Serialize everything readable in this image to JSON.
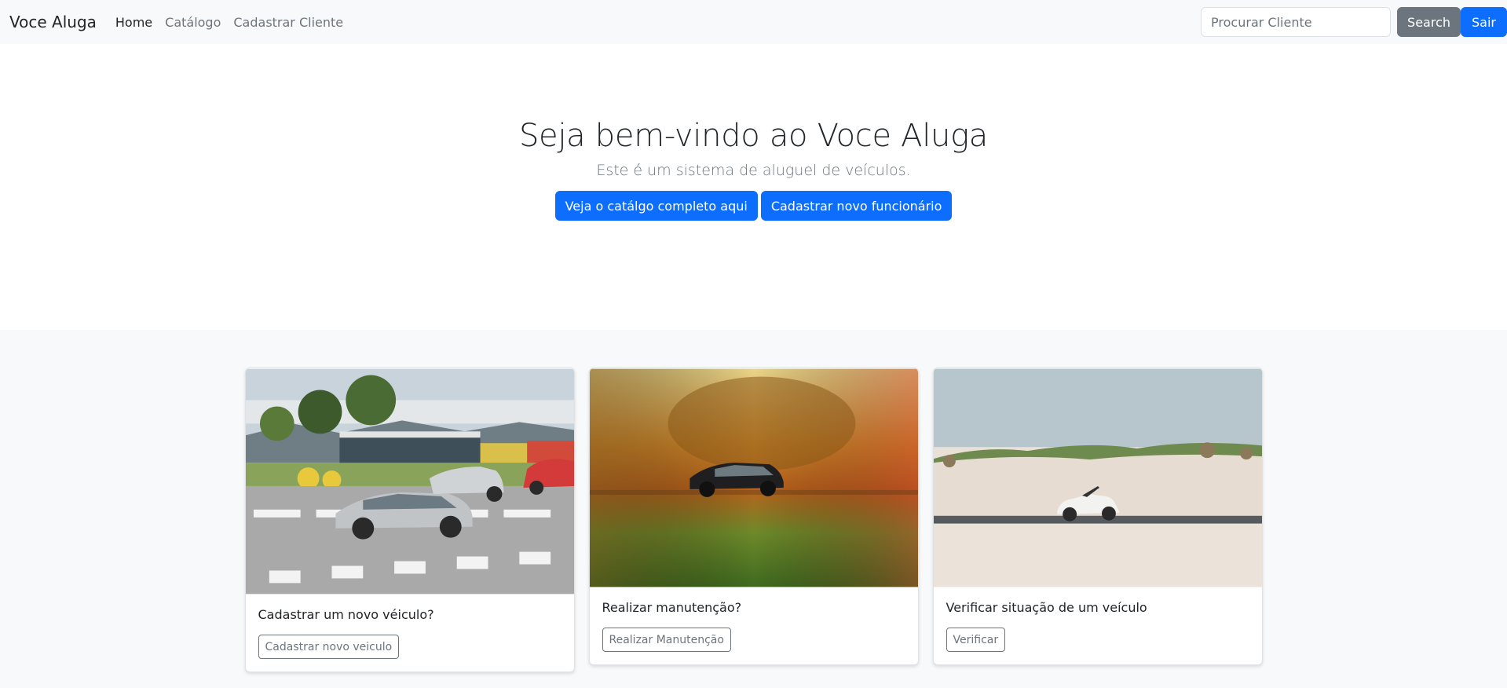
{
  "navbar": {
    "brand": "Voce Aluga",
    "links": [
      {
        "label": "Home"
      },
      {
        "label": "Catálogo"
      },
      {
        "label": "Cadastrar Cliente"
      }
    ],
    "search_placeholder": "Procurar Cliente",
    "search_button": "Search",
    "logout_button": "Sair"
  },
  "hero": {
    "title": "Seja bem-vindo ao Voce Aluga",
    "subtitle": "Este é um sistema de aluguel de veículos.",
    "primary_button": "Veja o catálgo completo aqui",
    "secondary_button": "Cadastrar novo funcionário"
  },
  "cards": [
    {
      "text": "Cadastrar um novo véiculo?",
      "button": "Cadastrar novo veiculo"
    },
    {
      "text": "Realizar manutenção?",
      "button": "Realizar Manutenção"
    },
    {
      "text": "Verificar situação de um veículo",
      "button": "Verificar"
    }
  ],
  "colors": {
    "primary": "#0d6efd",
    "secondary": "#6c757d",
    "light": "#f8f9fa"
  }
}
